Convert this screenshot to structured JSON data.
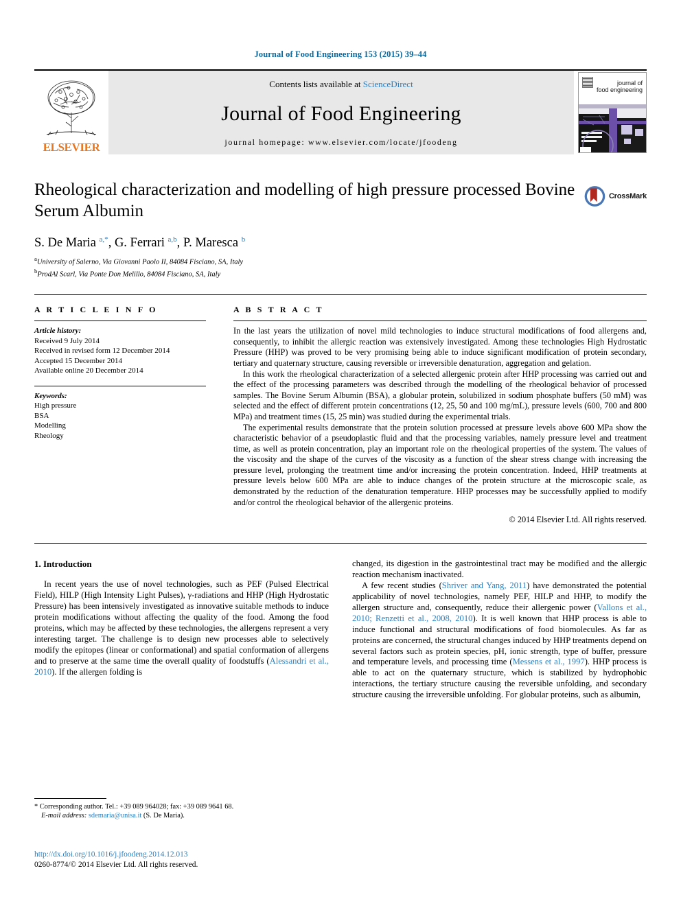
{
  "running_head": "Journal of Food Engineering 153 (2015) 39–44",
  "masthead": {
    "elsevier_wordmark": "ELSEVIER",
    "contents_prefix": "Contents lists available at",
    "sciencedirect": "ScienceDirect",
    "journal_title": "Journal of Food Engineering",
    "homepage": "journal homepage: www.elsevier.com/locate/jfoodeng",
    "cover_title_line1": "journal of",
    "cover_title_line2": "food engineering"
  },
  "article": {
    "title": "Rheological characterization and modelling of high pressure processed Bovine Serum Albumin",
    "crossmark_label": "CrossMark",
    "authors_html": "S. De Maria <sup>a,*</sup>, G. Ferrari <sup>a,b</sup>, P. Maresca <sup>b</sup>",
    "affiliations": [
      {
        "marker": "a",
        "text": "University of Salerno, Via Giovanni Paolo II, 84084 Fisciano, SA, Italy"
      },
      {
        "marker": "b",
        "text": "ProdAl Scarl, Via Ponte Don Melillo, 84084 Fisciano, SA, Italy"
      }
    ]
  },
  "article_info": {
    "heading": "A R T I C L E    I N F O",
    "history_label": "Article history:",
    "history": [
      "Received 9 July 2014",
      "Received in revised form 12 December 2014",
      "Accepted 15 December 2014",
      "Available online 20 December 2014"
    ],
    "keywords_label": "Keywords:",
    "keywords": [
      "High pressure",
      "BSA",
      "Modelling",
      "Rheology"
    ]
  },
  "abstract": {
    "heading": "A B S T R A C T",
    "paragraphs": [
      "In the last years the utilization of novel mild technologies to induce structural modifications of food allergens and, consequently, to inhibit the allergic reaction was extensively investigated. Among these technologies High Hydrostatic Pressure (HHP) was proved to be very promising being able to induce significant modification of protein secondary, tertiary and quaternary structure, causing reversible or irreversible denaturation, aggregation and gelation.",
      "In this work the rheological characterization of a selected allergenic protein after HHP processing was carried out and the effect of the processing parameters was described through the modelling of the rheological behavior of processed samples. The Bovine Serum Albumin (BSA), a globular protein, solubilized in sodium phosphate buffers (50 mM) was selected and the effect of different protein concentrations (12, 25, 50 and 100 mg/mL), pressure levels (600, 700 and 800 MPa) and treatment times (15, 25 min) was studied during the experimental trials.",
      "The experimental results demonstrate that the protein solution processed at pressure levels above 600 MPa show the characteristic behavior of a pseudoplastic fluid and that the processing variables, namely pressure level and treatment time, as well as protein concentration, play an important role on the rheological properties of the system. The values of the viscosity and the shape of the curves of the viscosity as a function of the shear stress change with increasing the pressure level, prolonging the treatment time and/or increasing the protein concentration. Indeed, HHP treatments at pressure levels below 600 MPa are able to induce changes of the protein structure at the microscopic scale, as demonstrated by the reduction of the denaturation temperature. HHP processes may be successfully applied to modify and/or control the rheological behavior of the allergenic proteins."
    ],
    "copyright": "© 2014 Elsevier Ltd. All rights reserved."
  },
  "introduction": {
    "section_title": "1. Introduction",
    "left_paragraph_1_a": "In recent years the use of novel technologies, such as PEF (Pulsed Electrical Field), HILP (High Intensity Light Pulses), γ-radiations and HHP (High Hydrostatic Pressure) has been intensively investigated as innovative suitable methods to induce protein modifications without affecting the quality of the food. Among the food proteins, which may be affected by these technologies, the allergens represent a very interesting target. The challenge is to design new processes able to selectively modify the epitopes (linear or conformational) and spatial conformation of allergens and to preserve at the same time the overall quality of foodstuffs (",
    "cite_alessandri": "Alessandri et al., 2010",
    "left_paragraph_1_b": "). If the allergen folding is",
    "right_paragraph_1": "changed, its digestion in the gastrointestinal tract may be modified and the allergic reaction mechanism inactivated.",
    "right_paragraph_2_a": "A few recent studies (",
    "cite_shriver": "Shriver and Yang, 2011",
    "right_paragraph_2_b": ") have demonstrated the potential applicability of novel technologies, namely PEF, HILP and HHP, to modify the allergen structure and, consequently, reduce their allergenic power (",
    "cite_vallons": "Vallons et al., 2010;",
    "cite_renzetti": "Renzetti et al., 2008, 2010",
    "right_paragraph_2_c": "). It is well known that HHP process is able to induce functional and structural modifications of food biomolecules. As far as proteins are concerned, the structural changes induced by HHP treatments depend on several factors such as protein species, pH, ionic strength, type of buffer, pressure and temperature levels, and processing time (",
    "cite_messens": "Messens et al., 1997",
    "right_paragraph_2_d": "). HHP process is able to act on the quaternary structure, which is stabilized by hydrophobic interactions, the tertiary structure causing the reversible unfolding, and secondary structure causing the irreversible unfolding. For globular proteins, such as albumin,"
  },
  "footnote": {
    "star": "*",
    "corresponding": "Corresponding author. Tel.: +39 089 964028; fax: +39 089 9641 68.",
    "email_label": "E-mail address:",
    "email": "sdemaria@unisa.it",
    "email_owner": "(S. De Maria)."
  },
  "footer": {
    "doi": "http://dx.doi.org/10.1016/j.jfoodeng.2014.12.013",
    "issn_line": "0260-8774/© 2014 Elsevier Ltd. All rights reserved."
  },
  "colors": {
    "link": "#2a7fc0",
    "elsevier_orange": "#E87722",
    "running_head": "#0b6a9e"
  }
}
